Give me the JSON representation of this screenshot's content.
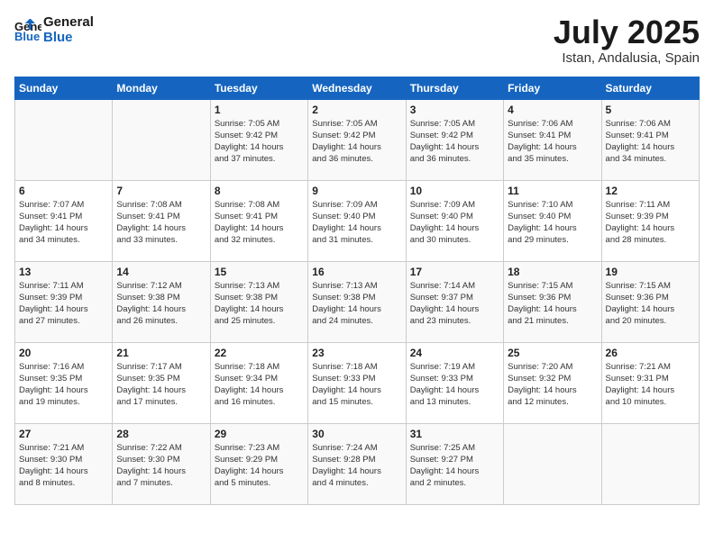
{
  "logo": {
    "line1": "General",
    "line2": "Blue"
  },
  "title": "July 2025",
  "location": "Istan, Andalusia, Spain",
  "weekdays": [
    "Sunday",
    "Monday",
    "Tuesday",
    "Wednesday",
    "Thursday",
    "Friday",
    "Saturday"
  ],
  "weeks": [
    [
      {
        "day": "",
        "info": ""
      },
      {
        "day": "",
        "info": ""
      },
      {
        "day": "1",
        "info": "Sunrise: 7:05 AM\nSunset: 9:42 PM\nDaylight: 14 hours\nand 37 minutes."
      },
      {
        "day": "2",
        "info": "Sunrise: 7:05 AM\nSunset: 9:42 PM\nDaylight: 14 hours\nand 36 minutes."
      },
      {
        "day": "3",
        "info": "Sunrise: 7:05 AM\nSunset: 9:42 PM\nDaylight: 14 hours\nand 36 minutes."
      },
      {
        "day": "4",
        "info": "Sunrise: 7:06 AM\nSunset: 9:41 PM\nDaylight: 14 hours\nand 35 minutes."
      },
      {
        "day": "5",
        "info": "Sunrise: 7:06 AM\nSunset: 9:41 PM\nDaylight: 14 hours\nand 34 minutes."
      }
    ],
    [
      {
        "day": "6",
        "info": "Sunrise: 7:07 AM\nSunset: 9:41 PM\nDaylight: 14 hours\nand 34 minutes."
      },
      {
        "day": "7",
        "info": "Sunrise: 7:08 AM\nSunset: 9:41 PM\nDaylight: 14 hours\nand 33 minutes."
      },
      {
        "day": "8",
        "info": "Sunrise: 7:08 AM\nSunset: 9:41 PM\nDaylight: 14 hours\nand 32 minutes."
      },
      {
        "day": "9",
        "info": "Sunrise: 7:09 AM\nSunset: 9:40 PM\nDaylight: 14 hours\nand 31 minutes."
      },
      {
        "day": "10",
        "info": "Sunrise: 7:09 AM\nSunset: 9:40 PM\nDaylight: 14 hours\nand 30 minutes."
      },
      {
        "day": "11",
        "info": "Sunrise: 7:10 AM\nSunset: 9:40 PM\nDaylight: 14 hours\nand 29 minutes."
      },
      {
        "day": "12",
        "info": "Sunrise: 7:11 AM\nSunset: 9:39 PM\nDaylight: 14 hours\nand 28 minutes."
      }
    ],
    [
      {
        "day": "13",
        "info": "Sunrise: 7:11 AM\nSunset: 9:39 PM\nDaylight: 14 hours\nand 27 minutes."
      },
      {
        "day": "14",
        "info": "Sunrise: 7:12 AM\nSunset: 9:38 PM\nDaylight: 14 hours\nand 26 minutes."
      },
      {
        "day": "15",
        "info": "Sunrise: 7:13 AM\nSunset: 9:38 PM\nDaylight: 14 hours\nand 25 minutes."
      },
      {
        "day": "16",
        "info": "Sunrise: 7:13 AM\nSunset: 9:38 PM\nDaylight: 14 hours\nand 24 minutes."
      },
      {
        "day": "17",
        "info": "Sunrise: 7:14 AM\nSunset: 9:37 PM\nDaylight: 14 hours\nand 23 minutes."
      },
      {
        "day": "18",
        "info": "Sunrise: 7:15 AM\nSunset: 9:36 PM\nDaylight: 14 hours\nand 21 minutes."
      },
      {
        "day": "19",
        "info": "Sunrise: 7:15 AM\nSunset: 9:36 PM\nDaylight: 14 hours\nand 20 minutes."
      }
    ],
    [
      {
        "day": "20",
        "info": "Sunrise: 7:16 AM\nSunset: 9:35 PM\nDaylight: 14 hours\nand 19 minutes."
      },
      {
        "day": "21",
        "info": "Sunrise: 7:17 AM\nSunset: 9:35 PM\nDaylight: 14 hours\nand 17 minutes."
      },
      {
        "day": "22",
        "info": "Sunrise: 7:18 AM\nSunset: 9:34 PM\nDaylight: 14 hours\nand 16 minutes."
      },
      {
        "day": "23",
        "info": "Sunrise: 7:18 AM\nSunset: 9:33 PM\nDaylight: 14 hours\nand 15 minutes."
      },
      {
        "day": "24",
        "info": "Sunrise: 7:19 AM\nSunset: 9:33 PM\nDaylight: 14 hours\nand 13 minutes."
      },
      {
        "day": "25",
        "info": "Sunrise: 7:20 AM\nSunset: 9:32 PM\nDaylight: 14 hours\nand 12 minutes."
      },
      {
        "day": "26",
        "info": "Sunrise: 7:21 AM\nSunset: 9:31 PM\nDaylight: 14 hours\nand 10 minutes."
      }
    ],
    [
      {
        "day": "27",
        "info": "Sunrise: 7:21 AM\nSunset: 9:30 PM\nDaylight: 14 hours\nand 8 minutes."
      },
      {
        "day": "28",
        "info": "Sunrise: 7:22 AM\nSunset: 9:30 PM\nDaylight: 14 hours\nand 7 minutes."
      },
      {
        "day": "29",
        "info": "Sunrise: 7:23 AM\nSunset: 9:29 PM\nDaylight: 14 hours\nand 5 minutes."
      },
      {
        "day": "30",
        "info": "Sunrise: 7:24 AM\nSunset: 9:28 PM\nDaylight: 14 hours\nand 4 minutes."
      },
      {
        "day": "31",
        "info": "Sunrise: 7:25 AM\nSunset: 9:27 PM\nDaylight: 14 hours\nand 2 minutes."
      },
      {
        "day": "",
        "info": ""
      },
      {
        "day": "",
        "info": ""
      }
    ]
  ]
}
